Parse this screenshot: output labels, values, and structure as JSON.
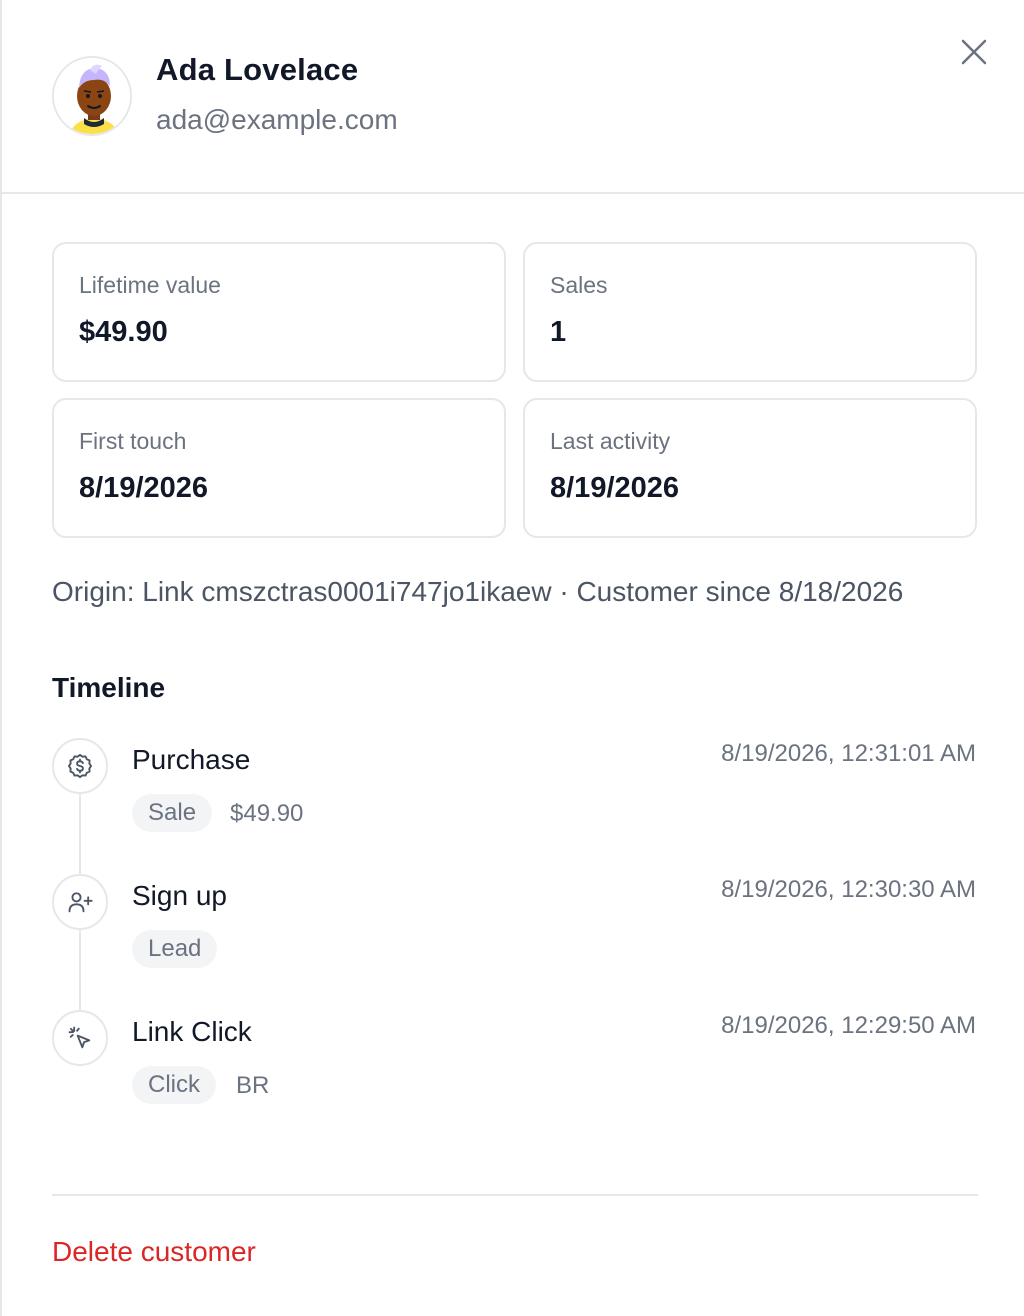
{
  "customer": {
    "name": "Ada Lovelace",
    "email": "ada@example.com"
  },
  "stats": [
    {
      "label": "Lifetime value",
      "value": "$49.90"
    },
    {
      "label": "Sales",
      "value": "1"
    },
    {
      "label": "First touch",
      "value": "8/19/2026"
    },
    {
      "label": "Last activity",
      "value": "8/19/2026"
    }
  ],
  "origin": "Origin: Link cmszctras0001i747jo1ikaew · Customer since 8/18/2026",
  "timeline": {
    "title": "Timeline",
    "events": [
      {
        "title": "Purchase",
        "time": "8/19/2026, 12:31:01 AM",
        "badge": "Sale",
        "extra": "$49.90",
        "icon": "dollar-circle-icon"
      },
      {
        "title": "Sign up",
        "time": "8/19/2026, 12:30:30 AM",
        "badge": "Lead",
        "extra": "",
        "icon": "user-plus-icon"
      },
      {
        "title": "Link Click",
        "time": "8/19/2026, 12:29:50 AM",
        "badge": "Click",
        "extra": "BR",
        "icon": "cursor-click-icon"
      }
    ]
  },
  "actions": {
    "delete_label": "Delete customer"
  },
  "colors": {
    "danger": "#dc2626",
    "border": "#e5e7eb",
    "muted_text": "#6b7280",
    "badge_bg": "#f3f4f6"
  }
}
